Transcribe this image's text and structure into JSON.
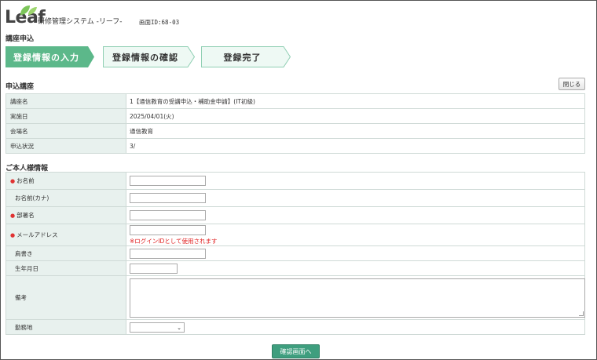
{
  "header": {
    "logo_text": "Leaf",
    "system_name": "研修管理システム -リーフ-",
    "screen_id": "画面ID:68-03"
  },
  "page_title": "講座申込",
  "steps": [
    {
      "label": "登録情報の入力",
      "active": true
    },
    {
      "label": "登録情報の確認",
      "active": false
    },
    {
      "label": "登録完了",
      "active": false
    }
  ],
  "course": {
    "section_title": "申込講座",
    "close_label": "閉じる",
    "rows": [
      {
        "label": "講座名",
        "value": "1【通信教育の受講申込・補助金申請】(IT初級)"
      },
      {
        "label": "実施日",
        "value": "2025/04/01(火)"
      },
      {
        "label": "会場名",
        "value": "通信教育"
      },
      {
        "label": "申込状況",
        "value": "3/"
      }
    ]
  },
  "applicant": {
    "section_title": "ご本人様情報",
    "required_mark": "●",
    "fields": {
      "name": {
        "label": "お名前",
        "required": true,
        "value": ""
      },
      "name_kana": {
        "label": "お名前(カナ)",
        "required": false,
        "value": ""
      },
      "department": {
        "label": "部署名",
        "required": true,
        "value": ""
      },
      "email": {
        "label": "メールアドレス",
        "required": true,
        "value": "",
        "note": "※ログインIDとして使用されます"
      },
      "title": {
        "label": "肩書き",
        "required": false,
        "value": ""
      },
      "birthdate": {
        "label": "生年月日",
        "required": false,
        "value": ""
      },
      "remarks": {
        "label": "備考",
        "required": false,
        "value": ""
      },
      "workplace": {
        "label": "勤務地",
        "required": false,
        "value": ""
      }
    }
  },
  "confirm_label": "確認画面へ",
  "colors": {
    "accent": "#5cb88a",
    "label_bg": "#e8f1ee",
    "step_inactive_bg": "#eef9f4",
    "button": "#3e9e7e",
    "required": "#e03333"
  }
}
